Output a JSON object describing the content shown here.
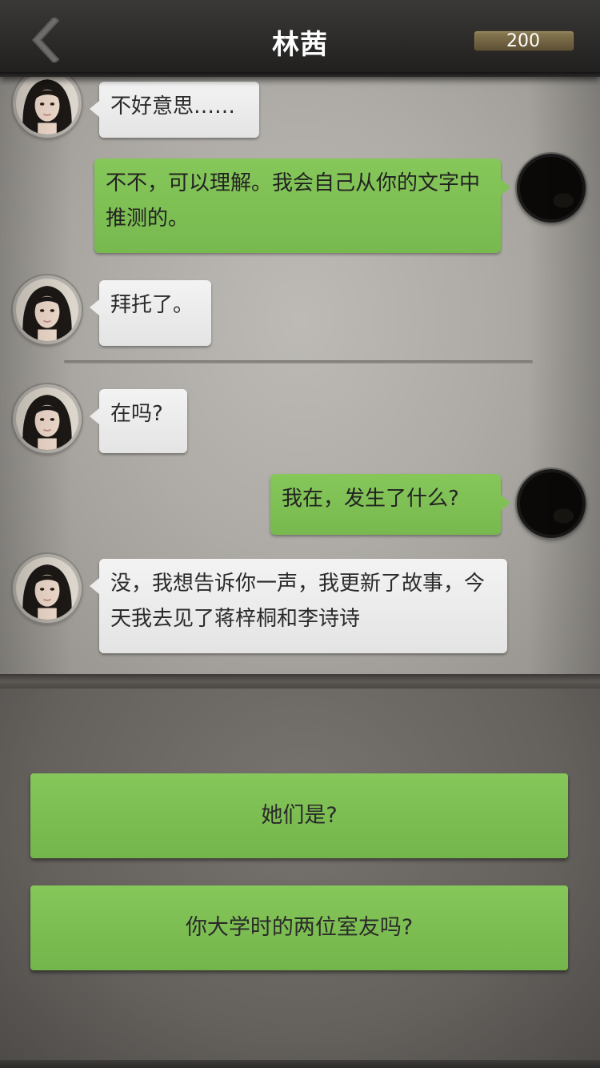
{
  "header": {
    "title": "林茜",
    "coins": "200"
  },
  "messages": [
    {
      "from": "contact",
      "text": "不好意思……"
    },
    {
      "from": "self",
      "text": "不不，可以理解。我会自己从你的文字中推测的。"
    },
    {
      "from": "contact",
      "text": "拜托了。"
    },
    {
      "from": "contact",
      "text": "在吗?"
    },
    {
      "from": "self",
      "text": "我在，发生了什么?"
    },
    {
      "from": "contact",
      "text": "没，我想告诉你一声，我更新了故事，今天我去见了蒋梓桐和李诗诗"
    }
  ],
  "choices": [
    {
      "label": "她们是?"
    },
    {
      "label": "你大学时的两位室友吗?"
    }
  ],
  "colors": {
    "bubble_out": "#80c055",
    "bubble_in": "#ececec",
    "choice": "#7dbd51",
    "header": "#2a2928"
  }
}
